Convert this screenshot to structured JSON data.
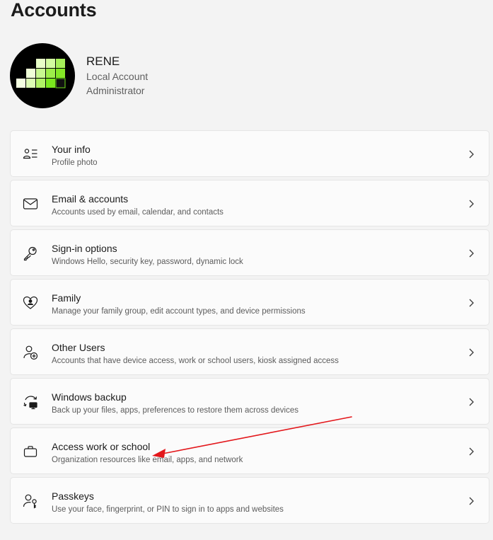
{
  "page": {
    "title": "Accounts"
  },
  "profile": {
    "name": "RENE",
    "account_type": "Local Account",
    "role": "Administrator"
  },
  "items": [
    {
      "title": "Your info",
      "subtitle": "Profile photo",
      "icon": "user-info-icon"
    },
    {
      "title": "Email & accounts",
      "subtitle": "Accounts used by email, calendar, and contacts",
      "icon": "mail-icon"
    },
    {
      "title": "Sign-in options",
      "subtitle": "Windows Hello, security key, password, dynamic lock",
      "icon": "key-icon"
    },
    {
      "title": "Family",
      "subtitle": "Manage your family group, edit account types, and device permissions",
      "icon": "family-heart-icon"
    },
    {
      "title": "Other Users",
      "subtitle": "Accounts that have device access, work or school users, kiosk assigned access",
      "icon": "add-user-icon"
    },
    {
      "title": "Windows backup",
      "subtitle": "Back up your files, apps, preferences to restore them across devices",
      "icon": "backup-sync-icon"
    },
    {
      "title": "Access work or school",
      "subtitle": "Organization resources like email, apps, and network",
      "icon": "briefcase-icon"
    },
    {
      "title": "Passkeys",
      "subtitle": "Use your face, fingerprint, or PIN to sign in to apps and websites",
      "icon": "passkey-icon"
    }
  ],
  "annotation": {
    "arrow_color": "#e3171b",
    "target_item": "Access work or school"
  },
  "colors": {
    "background": "#f3f3f3",
    "card": "#fbfbfb",
    "card_border": "#e5e5e5",
    "avatar_green_light": "#e8ffc8",
    "avatar_green_mid": "#b6f36a",
    "avatar_green_bright": "#7ae81e"
  }
}
